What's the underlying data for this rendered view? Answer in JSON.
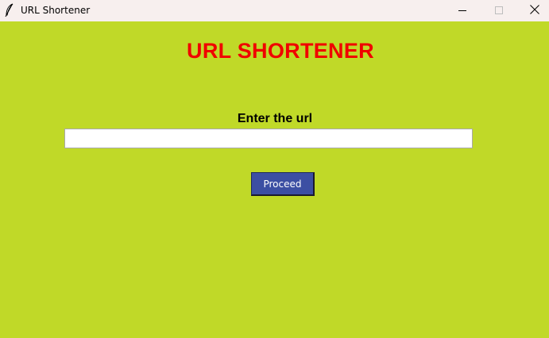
{
  "window": {
    "title": "URL Shortener",
    "icon": "feather-icon",
    "controls": {
      "minimize_icon": "minimize-icon",
      "maximize_icon": "maximize-icon",
      "close_icon": "close-icon"
    }
  },
  "main": {
    "heading": "URL SHORTENER",
    "url_label": "Enter the url",
    "url_input": {
      "value": "",
      "placeholder": ""
    },
    "proceed_label": "Proceed"
  },
  "colors": {
    "background": "#c0d928",
    "heading": "#f00000",
    "button_bg": "#3c4fa3",
    "button_text": "#ffffff",
    "titlebar": "#f7efee"
  }
}
